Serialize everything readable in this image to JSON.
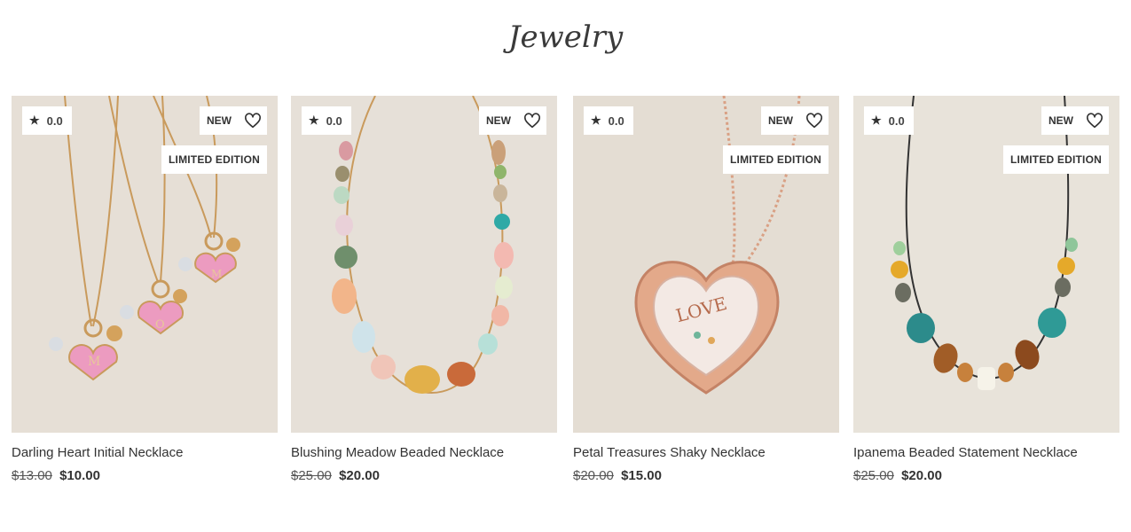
{
  "section": {
    "title": "Jewelry"
  },
  "badges": {
    "new": "NEW",
    "limited": "LIMITED EDITION"
  },
  "icons": {
    "rating": "star-icon",
    "wishlist": "heart-outline-icon"
  },
  "products": [
    {
      "name": "Darling Heart Initial Necklace",
      "rating": "0.0",
      "old_price": "$13.00",
      "price": "$10.00",
      "is_new": true,
      "limited": true
    },
    {
      "name": "Blushing Meadow Beaded Necklace",
      "rating": "0.0",
      "old_price": "$25.00",
      "price": "$20.00",
      "is_new": true,
      "limited": false
    },
    {
      "name": "Petal Treasures Shaky Necklace",
      "rating": "0.0",
      "old_price": "$20.00",
      "price": "$15.00",
      "is_new": true,
      "limited": true
    },
    {
      "name": "Ipanema Beaded Statement Necklace",
      "rating": "0.0",
      "old_price": "$25.00",
      "price": "$20.00",
      "is_new": true,
      "limited": true
    }
  ]
}
